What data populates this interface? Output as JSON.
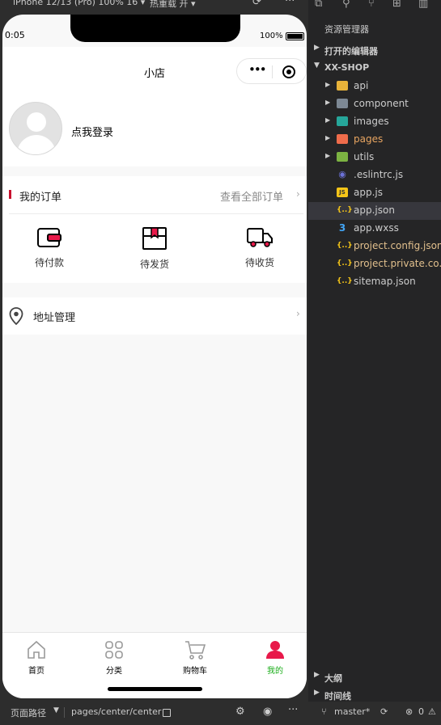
{
  "simulator": {
    "device_label": "iPhone 12/13 (Pro) 100% 16 ▾",
    "hot_reload_label": "热重载 开 ▾",
    "status_time": "0:05",
    "battery_text": "100%",
    "nav_title": "小店",
    "capsule_dots": "•••"
  },
  "profile": {
    "login_text": "点我登录"
  },
  "orders": {
    "header": "我的订单",
    "view_all": "查看全部订单",
    "items": [
      {
        "label": "待付款",
        "icon": "wallet-icon"
      },
      {
        "label": "待发货",
        "icon": "box-icon"
      },
      {
        "label": "待收货",
        "icon": "truck-icon"
      }
    ],
    "accent_color": "#c8102e"
  },
  "address": {
    "label": "地址管理"
  },
  "chevron": "›",
  "tabbar": {
    "items": [
      {
        "label": "首页",
        "icon": "home-icon",
        "active": false
      },
      {
        "label": "分类",
        "icon": "category-icon",
        "active": false
      },
      {
        "label": "购物车",
        "icon": "cart-icon",
        "active": false
      },
      {
        "label": "我的",
        "icon": "user-icon",
        "active": true
      }
    ],
    "active_color": "#1aad19",
    "active_icon_color": "#e8194a"
  },
  "bottom_bar": {
    "path_label": "页面路径",
    "path_value": "pages/center/center",
    "bug_glyph": "⚙",
    "eye_glyph": "◉",
    "more_glyph": "···"
  },
  "explorer": {
    "title": "资源管理器",
    "open_editors": "打开的编辑器",
    "project": "XX-SHOP",
    "items": [
      {
        "name": "api",
        "type": "folder",
        "icon_color": "#e8b33a"
      },
      {
        "name": "component",
        "type": "folder",
        "icon_color": "#7d8894"
      },
      {
        "name": "images",
        "type": "folder",
        "icon_color": "#26a69a"
      },
      {
        "name": "pages",
        "type": "folder",
        "icon_color": "#ef6c4b"
      },
      {
        "name": "utils",
        "type": "folder",
        "icon_color": "#7cb342"
      },
      {
        "name": ".eslintrc.js",
        "type": "file",
        "icon_color": "#6c72d9"
      },
      {
        "name": "app.js",
        "type": "file",
        "icon_color": "#f5c518"
      },
      {
        "name": "app.json",
        "type": "file",
        "icon_color": "#f5c518"
      },
      {
        "name": "app.wxss",
        "type": "file",
        "icon_color": "#42a5f5"
      },
      {
        "name": "project.config.json",
        "type": "file",
        "icon_color": "#f5c518"
      },
      {
        "name": "project.private.co...",
        "type": "file",
        "icon_color": "#f5c518"
      },
      {
        "name": "sitemap.json",
        "type": "file",
        "icon_color": "#f5c518"
      }
    ],
    "icon_glyphs": {
      "js": "JS",
      "json": "{..}",
      "css": "3",
      "eslint": "◉"
    },
    "outline": "大纲",
    "timeline": "时间线",
    "branch": "master*",
    "errors": "0",
    "warnings": "0"
  }
}
